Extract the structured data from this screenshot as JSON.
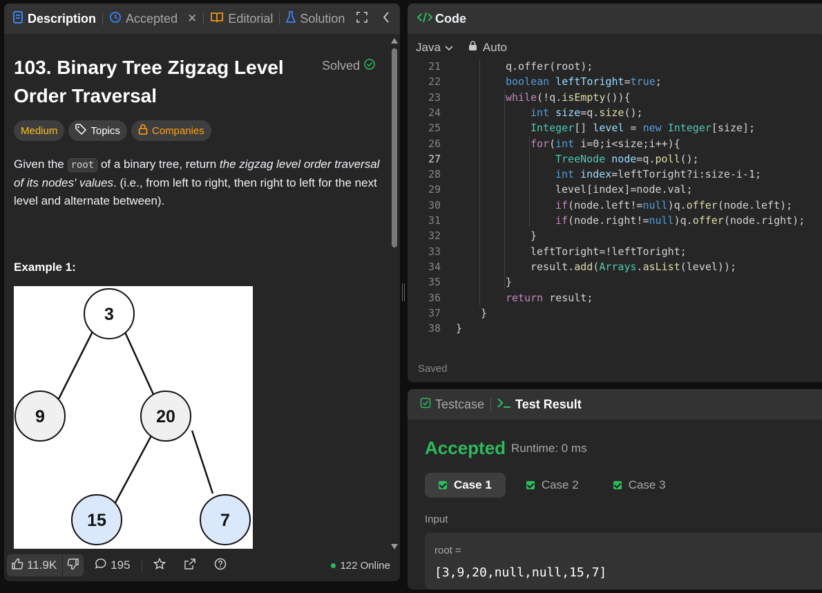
{
  "left_panel": {
    "tabs": [
      {
        "label": "Description",
        "icon": "document-icon",
        "active": true
      },
      {
        "label": "Accepted",
        "icon": "history-icon",
        "closable": true
      },
      {
        "label": "Editorial",
        "icon": "book-icon"
      },
      {
        "label": "Solution",
        "icon": "flask-icon"
      }
    ],
    "problem_title": "103. Binary Tree Zigzag Level Order Traversal",
    "solved_label": "Solved",
    "difficulty": "Medium",
    "topics_label": "Topics",
    "companies_label": "Companies",
    "description": {
      "part1": "Given the ",
      "code": "root",
      "part2": " of a binary tree, return ",
      "emphasis": "the zigzag level order traversal of its nodes' values",
      "part3": ". (i.e., from left to right, then right to left for the next level and alternate between)."
    },
    "example_heading": "Example 1:",
    "tree_nodes": {
      "root": "3",
      "left": "9",
      "right": "20",
      "right_left": "15",
      "right_right": "7"
    },
    "footer": {
      "likes": "11.9K",
      "comments": "195",
      "online": "122 Online"
    }
  },
  "code_panel": {
    "title": "Code",
    "language": "Java",
    "mode": "Auto",
    "status": "Saved",
    "current_line": 27,
    "lines": [
      {
        "n": "21",
        "indent": 2,
        "tokens": [
          [
            "q.offer(root);",
            "plain"
          ]
        ]
      },
      {
        "n": "22",
        "indent": 2,
        "tokens": [
          [
            "boolean",
            "kw"
          ],
          [
            " leftToright",
            "var"
          ],
          [
            "=",
            "plain"
          ],
          [
            "true",
            "kw"
          ],
          [
            ";",
            "plain"
          ]
        ]
      },
      {
        "n": "23",
        "indent": 2,
        "tokens": [
          [
            "while",
            "ctrl"
          ],
          [
            "(!q.",
            "plain"
          ],
          [
            "isEmpty",
            "fn"
          ],
          [
            "()){",
            "plain"
          ]
        ]
      },
      {
        "n": "24",
        "indent": 3,
        "tokens": [
          [
            "int",
            "kw"
          ],
          [
            " size",
            "var"
          ],
          [
            "=q.",
            "plain"
          ],
          [
            "size",
            "fn"
          ],
          [
            "();",
            "plain"
          ]
        ]
      },
      {
        "n": "25",
        "indent": 3,
        "tokens": [
          [
            "Integer",
            "type"
          ],
          [
            "[] ",
            "plain"
          ],
          [
            "level",
            "var"
          ],
          [
            " = ",
            "plain"
          ],
          [
            "new",
            "kw"
          ],
          [
            " ",
            "plain"
          ],
          [
            "Integer",
            "type"
          ],
          [
            "[size];",
            "plain"
          ]
        ]
      },
      {
        "n": "26",
        "indent": 3,
        "tokens": [
          [
            "for",
            "ctrl"
          ],
          [
            "(",
            "plain"
          ],
          [
            "int",
            "kw"
          ],
          [
            " i=0;i<size;i++){",
            "plain"
          ]
        ]
      },
      {
        "n": "27",
        "indent": 4,
        "tokens": [
          [
            "TreeNode",
            "type"
          ],
          [
            " node",
            "var"
          ],
          [
            "=q.",
            "plain"
          ],
          [
            "poll",
            "fn"
          ],
          [
            "();",
            "plain"
          ]
        ]
      },
      {
        "n": "28",
        "indent": 4,
        "tokens": [
          [
            "int",
            "kw"
          ],
          [
            " index",
            "var"
          ],
          [
            "=leftToright?i:size-i-1;",
            "plain"
          ]
        ]
      },
      {
        "n": "29",
        "indent": 4,
        "tokens": [
          [
            "level[index]=node.val;",
            "plain"
          ]
        ]
      },
      {
        "n": "30",
        "indent": 4,
        "tokens": [
          [
            "if",
            "ctrl"
          ],
          [
            "(node.left!=",
            "plain"
          ],
          [
            "null",
            "kw"
          ],
          [
            ")q.",
            "plain"
          ],
          [
            "offer",
            "fn"
          ],
          [
            "(node.left);",
            "plain"
          ]
        ]
      },
      {
        "n": "31",
        "indent": 4,
        "tokens": [
          [
            "if",
            "ctrl"
          ],
          [
            "(node.right!=",
            "plain"
          ],
          [
            "null",
            "kw"
          ],
          [
            ")q.",
            "plain"
          ],
          [
            "offer",
            "fn"
          ],
          [
            "(node.right);",
            "plain"
          ]
        ]
      },
      {
        "n": "32",
        "indent": 3,
        "tokens": [
          [
            "}",
            "plain"
          ]
        ]
      },
      {
        "n": "33",
        "indent": 3,
        "tokens": [
          [
            "leftToright=!leftToright;",
            "plain"
          ]
        ]
      },
      {
        "n": "34",
        "indent": 3,
        "tokens": [
          [
            "result.",
            "plain"
          ],
          [
            "add",
            "fn"
          ],
          [
            "(",
            "plain"
          ],
          [
            "Arrays",
            "type"
          ],
          [
            ".",
            "plain"
          ],
          [
            "asList",
            "fn"
          ],
          [
            "(level));",
            "plain"
          ]
        ]
      },
      {
        "n": "35",
        "indent": 2,
        "tokens": [
          [
            "}",
            "plain"
          ]
        ]
      },
      {
        "n": "36",
        "indent": 2,
        "tokens": [
          [
            "return",
            "ctrl"
          ],
          [
            " result;",
            "plain"
          ]
        ]
      },
      {
        "n": "37",
        "indent": 1,
        "tokens": [
          [
            "}",
            "plain"
          ]
        ]
      },
      {
        "n": "38",
        "indent": 0,
        "tokens": [
          [
            "}",
            "plain"
          ]
        ]
      }
    ]
  },
  "test_panel": {
    "tabs": [
      {
        "label": "Testcase",
        "icon": "checkbox-icon"
      },
      {
        "label": "Test Result",
        "icon": "terminal-icon",
        "active": true
      }
    ],
    "result": "Accepted",
    "runtime": "Runtime: 0 ms",
    "cases": [
      {
        "label": "Case 1",
        "active": true
      },
      {
        "label": "Case 2"
      },
      {
        "label": "Case 3"
      }
    ],
    "input_label": "Input",
    "input_var": "root =",
    "input_value": "[3,9,20,null,null,15,7]"
  },
  "colors": {
    "accent_green": "#2cbb5d",
    "medium": "#ffc01e",
    "companies": "#ffa116",
    "kw": "#569cd6",
    "ctrl": "#c586c0",
    "fn": "#dcdcaa",
    "type": "#4ec9b0",
    "var": "#9cdcfe",
    "plain": "#d4d4d4"
  }
}
